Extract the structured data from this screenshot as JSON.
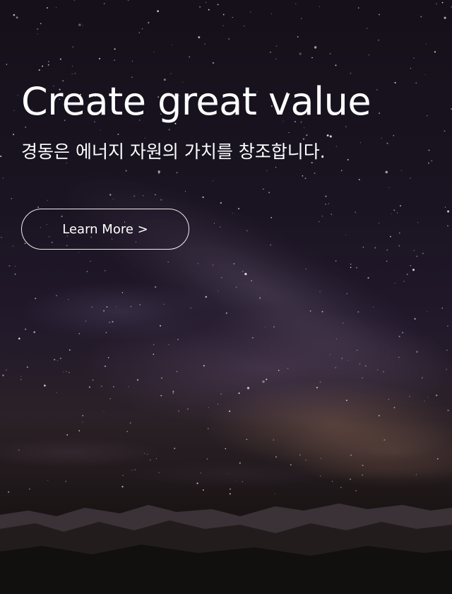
{
  "hero": {
    "headline": "Create great value",
    "subheadline": "경동은 에너지 자원의 가치를 창조합니다.",
    "cta_label": "Learn More >"
  },
  "colors": {
    "text": "#ffffff",
    "button_border": "#ffffff",
    "sky_top": "#151019",
    "horizon_glow": "#be8c6e"
  },
  "background": {
    "scene": "starry-night-sky-milky-way-over-mountains"
  }
}
